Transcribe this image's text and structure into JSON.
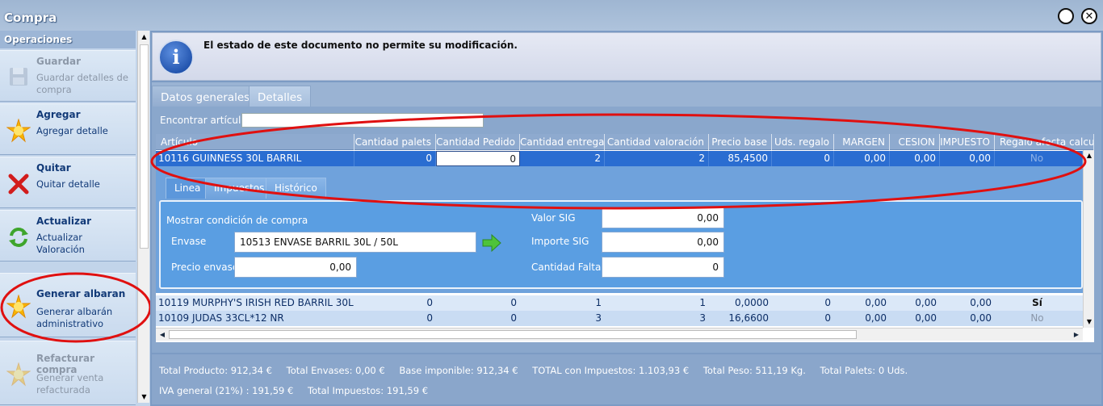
{
  "window": {
    "title": "Compra",
    "help_glyph": "",
    "close_glyph": "✕"
  },
  "sidebar": {
    "header": "Operaciones",
    "items": [
      {
        "title": "Guardar",
        "desc": "Guardar detalles de compra",
        "icon": "save-icon",
        "disabled": true
      },
      {
        "title": "Agregar",
        "desc": "Agregar detalle",
        "icon": "star-icon",
        "disabled": false
      },
      {
        "title": "Quitar",
        "desc": "Quitar detalle",
        "icon": "x-icon",
        "disabled": false
      },
      {
        "title": "Actualizar",
        "desc": "Actualizar Valoración",
        "icon": "refresh-icon",
        "disabled": false
      },
      {
        "title": "Generar albaran",
        "desc": "Generar albarán administrativo",
        "icon": "star-icon",
        "disabled": false
      },
      {
        "title": "Refacturar compra",
        "desc": "Generar venta refacturada",
        "icon": "star-icon",
        "disabled": true
      }
    ]
  },
  "info": {
    "message": "El estado de este documento no permite su modificación.",
    "icon_letter": "i"
  },
  "tabs": {
    "datos_generales": "Datos generales",
    "detalles": "Detalles"
  },
  "search": {
    "label": "Encontrar artículo",
    "value": ""
  },
  "grid": {
    "columns": [
      "Artículo",
      "Cantidad palets",
      "Cantidad Pedido",
      "Cantidad entrega",
      "Cantidad valoración",
      "Precio base",
      "Uds. regalo",
      "MARGEN",
      "CESION",
      "IMPUESTO",
      "Regalo afecta calcul"
    ],
    "selected_row": {
      "articulo": "10116 GUINNESS 30L BARRIL",
      "palets": "0",
      "pedido": "0",
      "entrega": "2",
      "valoracion": "2",
      "precio": "85,4500",
      "regalo": "0",
      "margen": "0,00",
      "cesion": "0,00",
      "impuesto": "0,00",
      "afecta": "No"
    },
    "rows": [
      {
        "articulo": "10119 MURPHY'S IRISH RED BARRIL 30L",
        "palets": "0",
        "pedido": "0",
        "entrega": "1",
        "valoracion": "1",
        "precio": "0,0000",
        "regalo": "0",
        "margen": "0,00",
        "cesion": "0,00",
        "impuesto": "0,00",
        "afecta": "Sí"
      },
      {
        "articulo": "10109 JUDAS 33CL*12 NR",
        "palets": "0",
        "pedido": "0",
        "entrega": "3",
        "valoracion": "3",
        "precio": "16,6600",
        "regalo": "0",
        "margen": "0,00",
        "cesion": "0,00",
        "impuesto": "0,00",
        "afecta": "No"
      }
    ]
  },
  "detail_tabs": {
    "linea": "Linea",
    "impuestos": "Impuestos",
    "historico": "Histórico"
  },
  "detail": {
    "mostrar_label": "Mostrar condición de compra",
    "envase_label": "Envase",
    "envase_value": "10513 ENVASE BARRIL 30L / 50L",
    "precio_envase_label": "Precio envase",
    "precio_envase_value": "0,00",
    "valor_sig_label": "Valor SIG",
    "valor_sig_value": "0,00",
    "importe_sig_label": "Importe SIG",
    "importe_sig_value": "0,00",
    "cantidad_faltas_label": "Cantidad Faltas",
    "cantidad_faltas_value": "0"
  },
  "footer": {
    "total_producto": "Total Producto: 912,34 €",
    "total_envases": "Total Envases: 0,00 €",
    "base_imponible": "Base imponible: 912,34 €",
    "total_con_impuestos": "TOTAL con Impuestos: 1.103,93 €",
    "total_peso": "Total Peso: 511,19 Kg.",
    "total_palets": "Total Palets: 0 Uds.",
    "iva_general": "IVA general (21%) : 191,59 €",
    "total_impuestos": "Total Impuestos: 191,59 €"
  },
  "colors": {
    "annotation_red": "#e01010",
    "selected_row": "#2a6dd1",
    "accent_blue": "#123a78"
  }
}
